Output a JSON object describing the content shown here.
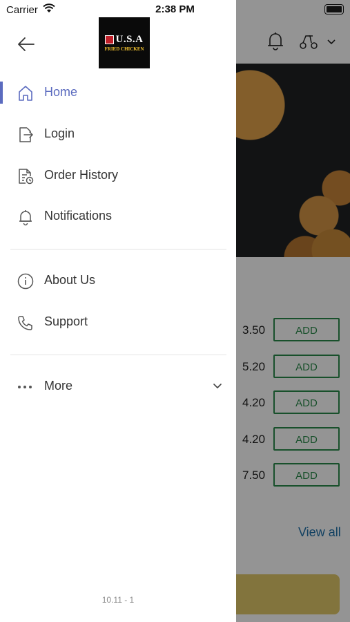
{
  "status_bar": {
    "carrier": "Carrier",
    "time": "2:38 PM"
  },
  "drawer": {
    "logo": {
      "main_text": "U.S.A",
      "sub_text": "FRIED CHICKEN"
    },
    "menu": [
      {
        "label": "Home",
        "icon": "home-icon",
        "active": true
      },
      {
        "label": "Login",
        "icon": "login-icon"
      },
      {
        "label": "Order History",
        "icon": "order-history-icon"
      },
      {
        "label": "Notifications",
        "icon": "bell-icon"
      },
      {
        "label": "About Us",
        "icon": "info-icon"
      },
      {
        "label": "Support",
        "icon": "phone-icon"
      },
      {
        "label": "More",
        "icon": "more-dots-icon"
      }
    ],
    "version": "10.11 - 1",
    "accent_color": "#5b6bbf"
  },
  "background": {
    "items": [
      {
        "price": "3.50",
        "button": "ADD"
      },
      {
        "price": "5.20",
        "button": "ADD"
      },
      {
        "price": "4.20",
        "button": "ADD"
      },
      {
        "price": "4.20",
        "button": "ADD"
      },
      {
        "price": "7.50",
        "button": "ADD"
      }
    ],
    "view_all": "View all"
  }
}
